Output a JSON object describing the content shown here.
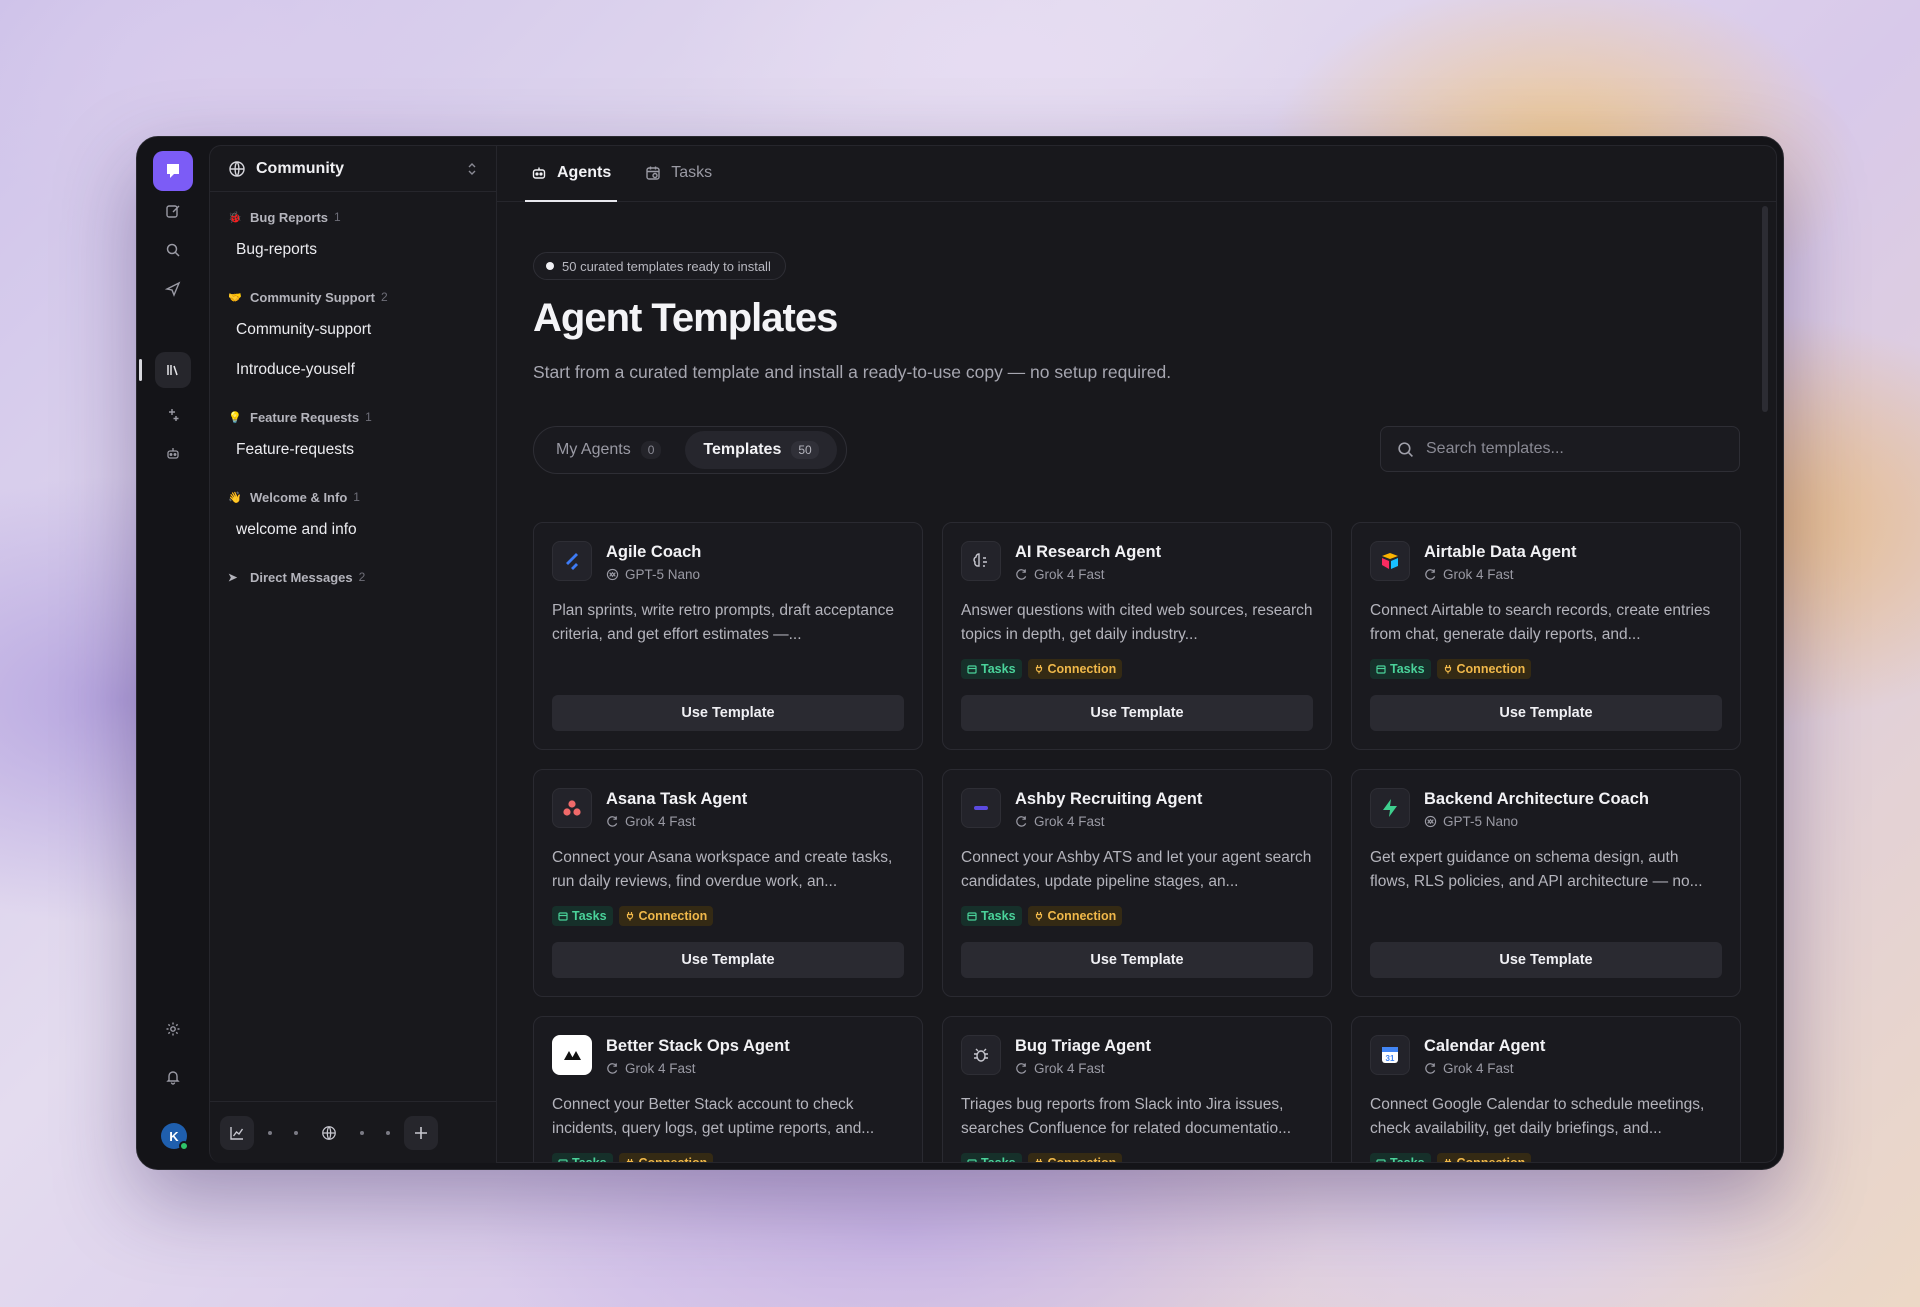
{
  "sidebar": {
    "workspace": "Community",
    "groups": [
      {
        "name": "Bug Reports",
        "count": "1",
        "emoji": "🐞",
        "channels": [
          "Bug-reports"
        ]
      },
      {
        "name": "Community Support",
        "count": "2",
        "emoji": "🤝",
        "channels": [
          "Community-support",
          "Introduce-youself"
        ]
      },
      {
        "name": "Feature Requests",
        "count": "1",
        "emoji": "💡",
        "channels": [
          "Feature-requests"
        ]
      },
      {
        "name": "Welcome & Info",
        "count": "1",
        "emoji": "👋",
        "channels": [
          "welcome and info"
        ]
      },
      {
        "name": "Direct Messages",
        "count": "2",
        "emoji": "➤",
        "channels": []
      }
    ]
  },
  "user": {
    "initial": "K"
  },
  "tabs": [
    {
      "label": "Agents"
    },
    {
      "label": "Tasks"
    }
  ],
  "hero": {
    "pill": "50 curated templates ready to install",
    "title": "Agent Templates",
    "subtitle": "Start from a curated template and install a ready-to-use copy — no setup required."
  },
  "segment": [
    {
      "label": "My Agents",
      "count": "0"
    },
    {
      "label": "Templates",
      "count": "50"
    }
  ],
  "search": {
    "placeholder": "Search templates..."
  },
  "badge_labels": {
    "tasks": "Tasks",
    "connection": "Connection"
  },
  "use_label": "Use Template",
  "cards": [
    {
      "name": "Agile Coach",
      "model": "GPT-5 Nano",
      "model_icon": "openai-icon",
      "desc": "Plan sprints, write retro prompts, draft acceptance criteria, and get effort estimates —...",
      "badges": false,
      "logo": "jira-icon",
      "logo_color": "#3d7bf5"
    },
    {
      "name": "AI Research Agent",
      "model": "Grok 4 Fast",
      "model_icon": "grok-icon",
      "desc": "Answer questions with cited web sources, research topics in depth, get daily industry...",
      "badges": true,
      "logo": "brain-icon",
      "logo_color": "#c8c8d0"
    },
    {
      "name": "Airtable Data Agent",
      "model": "Grok 4 Fast",
      "model_icon": "grok-icon",
      "desc": "Connect Airtable to search records, create entries from chat, generate daily reports, and...",
      "badges": true,
      "logo": "airtable-icon",
      "logo_color": "#fcb400"
    },
    {
      "name": "Asana Task Agent",
      "model": "Grok 4 Fast",
      "model_icon": "grok-icon",
      "desc": "Connect your Asana workspace and create tasks, run daily reviews, find overdue work, an...",
      "badges": true,
      "logo": "asana-icon",
      "logo_color": "#f06a6a"
    },
    {
      "name": "Ashby Recruiting Agent",
      "model": "Grok 4 Fast",
      "model_icon": "grok-icon",
      "desc": "Connect your Ashby ATS and let your agent search candidates, update pipeline stages, an...",
      "badges": true,
      "logo": "ashby-icon",
      "logo_color": "#5b4ae0"
    },
    {
      "name": "Backend Architecture Coach",
      "model": "GPT-5 Nano",
      "model_icon": "openai-icon",
      "desc": "Get expert guidance on schema design, auth flows, RLS policies, and API architecture — no...",
      "badges": false,
      "logo": "supabase-icon",
      "logo_color": "#3ecf8e"
    },
    {
      "name": "Better Stack Ops Agent",
      "model": "Grok 4 Fast",
      "model_icon": "grok-icon",
      "desc": "Connect your Better Stack account to check incidents, query logs, get uptime reports, and...",
      "badges": true,
      "logo": "betterstack-icon",
      "logo_color": "#ffffff"
    },
    {
      "name": "Bug Triage Agent",
      "model": "Grok 4 Fast",
      "model_icon": "grok-icon",
      "desc": "Triages bug reports from Slack into Jira issues, searches Confluence for related documentatio...",
      "badges": true,
      "logo": "bug-icon",
      "logo_color": "#c8c8d0"
    },
    {
      "name": "Calendar Agent",
      "model": "Grok 4 Fast",
      "model_icon": "grok-icon",
      "desc": "Connect Google Calendar to schedule meetings, check availability, get daily briefings, and...",
      "badges": true,
      "logo": "google-calendar-icon",
      "logo_color": "#4285f4"
    }
  ]
}
